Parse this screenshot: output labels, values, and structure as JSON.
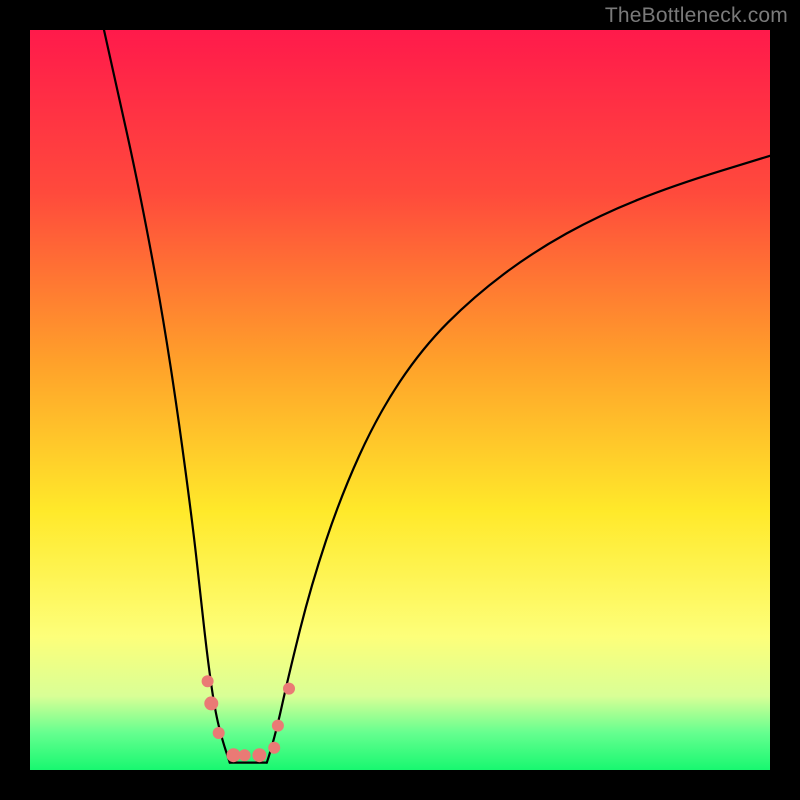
{
  "watermark": "TheBottleneck.com",
  "chart_data": {
    "type": "line",
    "title": "",
    "xlabel": "",
    "ylabel": "",
    "xlim": [
      0,
      100
    ],
    "ylim": [
      0,
      100
    ],
    "grid": false,
    "background_gradient": {
      "stops": [
        {
          "offset": 0,
          "color": "#ff1a4b"
        },
        {
          "offset": 22,
          "color": "#ff4a3c"
        },
        {
          "offset": 45,
          "color": "#ffa12a"
        },
        {
          "offset": 65,
          "color": "#ffe92a"
        },
        {
          "offset": 82,
          "color": "#fdff7a"
        },
        {
          "offset": 90,
          "color": "#d9ff96"
        },
        {
          "offset": 95,
          "color": "#65ff8f"
        },
        {
          "offset": 100,
          "color": "#18f770"
        }
      ]
    },
    "series": [
      {
        "name": "left-branch",
        "x": [
          10,
          12,
          14,
          16,
          18,
          20,
          22,
          23,
          24,
          25,
          26,
          27
        ],
        "y": [
          100,
          91,
          82,
          72,
          61,
          48,
          33,
          24,
          15,
          8,
          4,
          1
        ]
      },
      {
        "name": "right-branch",
        "x": [
          32,
          33,
          35,
          38,
          42,
          47,
          53,
          60,
          68,
          77,
          87,
          100
        ],
        "y": [
          1,
          4,
          13,
          25,
          37,
          48,
          57,
          64,
          70,
          75,
          79,
          83
        ]
      }
    ],
    "bottom_band": [
      {
        "name": "flat-bottom",
        "x": [
          27,
          32
        ],
        "y": [
          1,
          1
        ]
      }
    ],
    "markers": {
      "color": "#ea7a75",
      "points": [
        {
          "x": 24.0,
          "y": 12,
          "r": 6
        },
        {
          "x": 24.5,
          "y": 9,
          "r": 7
        },
        {
          "x": 25.5,
          "y": 5,
          "r": 6
        },
        {
          "x": 27.5,
          "y": 2,
          "r": 7
        },
        {
          "x": 29.0,
          "y": 2,
          "r": 6
        },
        {
          "x": 31.0,
          "y": 2,
          "r": 7
        },
        {
          "x": 33.0,
          "y": 3,
          "r": 6
        },
        {
          "x": 33.5,
          "y": 6,
          "r": 6
        },
        {
          "x": 35.0,
          "y": 11,
          "r": 6
        }
      ]
    }
  }
}
